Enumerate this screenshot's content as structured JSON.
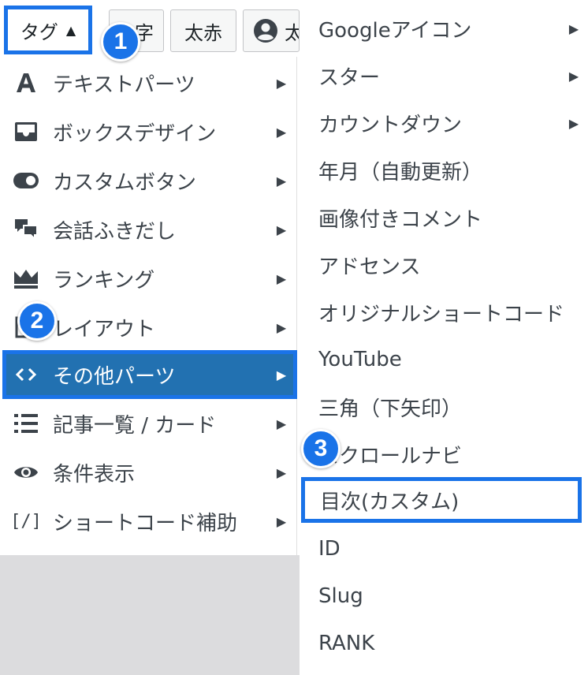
{
  "toolbar": {
    "tag_label": "タグ",
    "btn2_label": "字",
    "btn3_label": "太赤",
    "btn4_label": "太"
  },
  "badges": [
    "1",
    "2",
    "3"
  ],
  "left_menu": {
    "items": [
      {
        "label": "テキストパーツ",
        "icon": "text-a-icon"
      },
      {
        "label": "ボックスデザイン",
        "icon": "inbox-icon"
      },
      {
        "label": "カスタムボタン",
        "icon": "toggle-icon"
      },
      {
        "label": "会話ふきだし",
        "icon": "chat-bubbles-icon"
      },
      {
        "label": "ランキング",
        "icon": "crown-icon"
      },
      {
        "label": "レイアウト",
        "icon": "layout-icon"
      },
      {
        "label": "その他パーツ",
        "icon": "code-icon",
        "active": true
      },
      {
        "label": "記事一覧 / カード",
        "icon": "list-icon"
      },
      {
        "label": "条件表示",
        "icon": "eye-icon"
      },
      {
        "label": "ショートコード補助",
        "icon": "shortcode-icon"
      }
    ]
  },
  "sub_menu": {
    "items": [
      {
        "label": "Googleアイコン",
        "has_submenu": true
      },
      {
        "label": "スター",
        "has_submenu": true
      },
      {
        "label": "カウントダウン",
        "has_submenu": true
      },
      {
        "label": "年月（自動更新）"
      },
      {
        "label": "画像付きコメント"
      },
      {
        "label": "アドセンス"
      },
      {
        "label": "オリジナルショートコード"
      },
      {
        "label": "YouTube"
      },
      {
        "label": "三角（下矢印）"
      },
      {
        "label": "スクロールナビ"
      },
      {
        "label": "目次(カスタム)",
        "highlighted": true
      },
      {
        "label": "ID"
      },
      {
        "label": "Slug"
      },
      {
        "label": "RANK"
      }
    ]
  },
  "colors": {
    "accent": "#1a73e8",
    "active_bg": "#2271b1",
    "text": "#3c434a",
    "gray_bg": "#dcdcde"
  }
}
